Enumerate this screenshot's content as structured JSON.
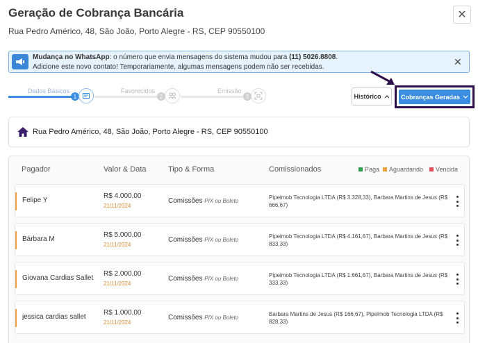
{
  "header": {
    "title": "Geração de Cobrança Bancária",
    "subtitle": "Rua Pedro Américo, 48, São João, Porto Alegre - RS, CEP 90550100",
    "close_label": "✕"
  },
  "banner": {
    "bold_label": "Mudança no WhatsApp",
    "line1_rest": ": o número que envia mensagens do sistema mudou para ",
    "phone": "(11) 5026.8808",
    "line1_end": ".",
    "line2": "Adicione este novo contato! Temporariamente, algumas mensagens podem não ser recebidas.",
    "close_label": "✕",
    "icon": "megaphone-icon"
  },
  "steps": [
    {
      "label": "Dados Básicos",
      "num": "1",
      "icon": "document-icon",
      "active": true
    },
    {
      "label": "Favorecidos",
      "num": "2",
      "icon": "users-icon",
      "active": false
    },
    {
      "label": "Emissão",
      "num": "3",
      "icon": "expand-icon",
      "active": false
    }
  ],
  "actions": {
    "historico_label": "Histórico",
    "cobrancas_label": "Cobranças Geradas"
  },
  "address_card": {
    "text": "Rua Pedro Américo, 48, São João, Porto Alegre - RS, CEP 90550100",
    "icon": "home-icon"
  },
  "table": {
    "headers": {
      "pagador": "Pagador",
      "valor": "Valor & Data",
      "tipo": "Tipo & Forma",
      "comissionados": "Comissionados"
    },
    "legend": [
      {
        "label": "Paga",
        "color": "#2e9e4f"
      },
      {
        "label": "Aguardando",
        "color": "#f0a040"
      },
      {
        "label": "Vencida",
        "color": "#e0505a"
      }
    ],
    "rows": [
      {
        "pagador": "Felipe Y",
        "valor": "R$ 4.000,00",
        "data": "21/11/2024",
        "tipo": "Comissões",
        "forma": "PIX ou Boleto",
        "comissionados": "Pipelmob Tecnologia LTDA (R$ 3.328,33), Barbara Martins de Jesus (R$ 666,67)"
      },
      {
        "pagador": "Bárbara M",
        "valor": "R$ 5.000,00",
        "data": "21/11/2024",
        "tipo": "Comissões",
        "forma": "PIX ou Boleto",
        "comissionados": "Pipelmob Tecnologia LTDA (R$ 4.161,67), Barbara Martins de Jesus (R$ 833,33)"
      },
      {
        "pagador": "Giovana Cardias Sallet",
        "valor": "R$ 2.000,00",
        "data": "21/11/2024",
        "tipo": "Comissões",
        "forma": "PIX ou Boleto",
        "comissionados": "Pipelmob Tecnologia LTDA (R$ 1.661,67), Barbara Martins de Jesus (R$ 333,33)"
      },
      {
        "pagador": "jessica cardias sallet",
        "valor": "R$ 1.000,00",
        "data": "21/11/2024",
        "tipo": "Comissões",
        "forma": "PIX ou Boleto",
        "comissionados": "Barbara Martins de Jesus (R$ 166,67), Pipelmob Tecnologia LTDA (R$ 828,33)"
      }
    ]
  },
  "colors": {
    "accent_blue": "#3b8ee0",
    "highlight_frame": "#2d0e4a",
    "pending_orange": "#f0a040",
    "home_icon": "#3b1f6b"
  }
}
